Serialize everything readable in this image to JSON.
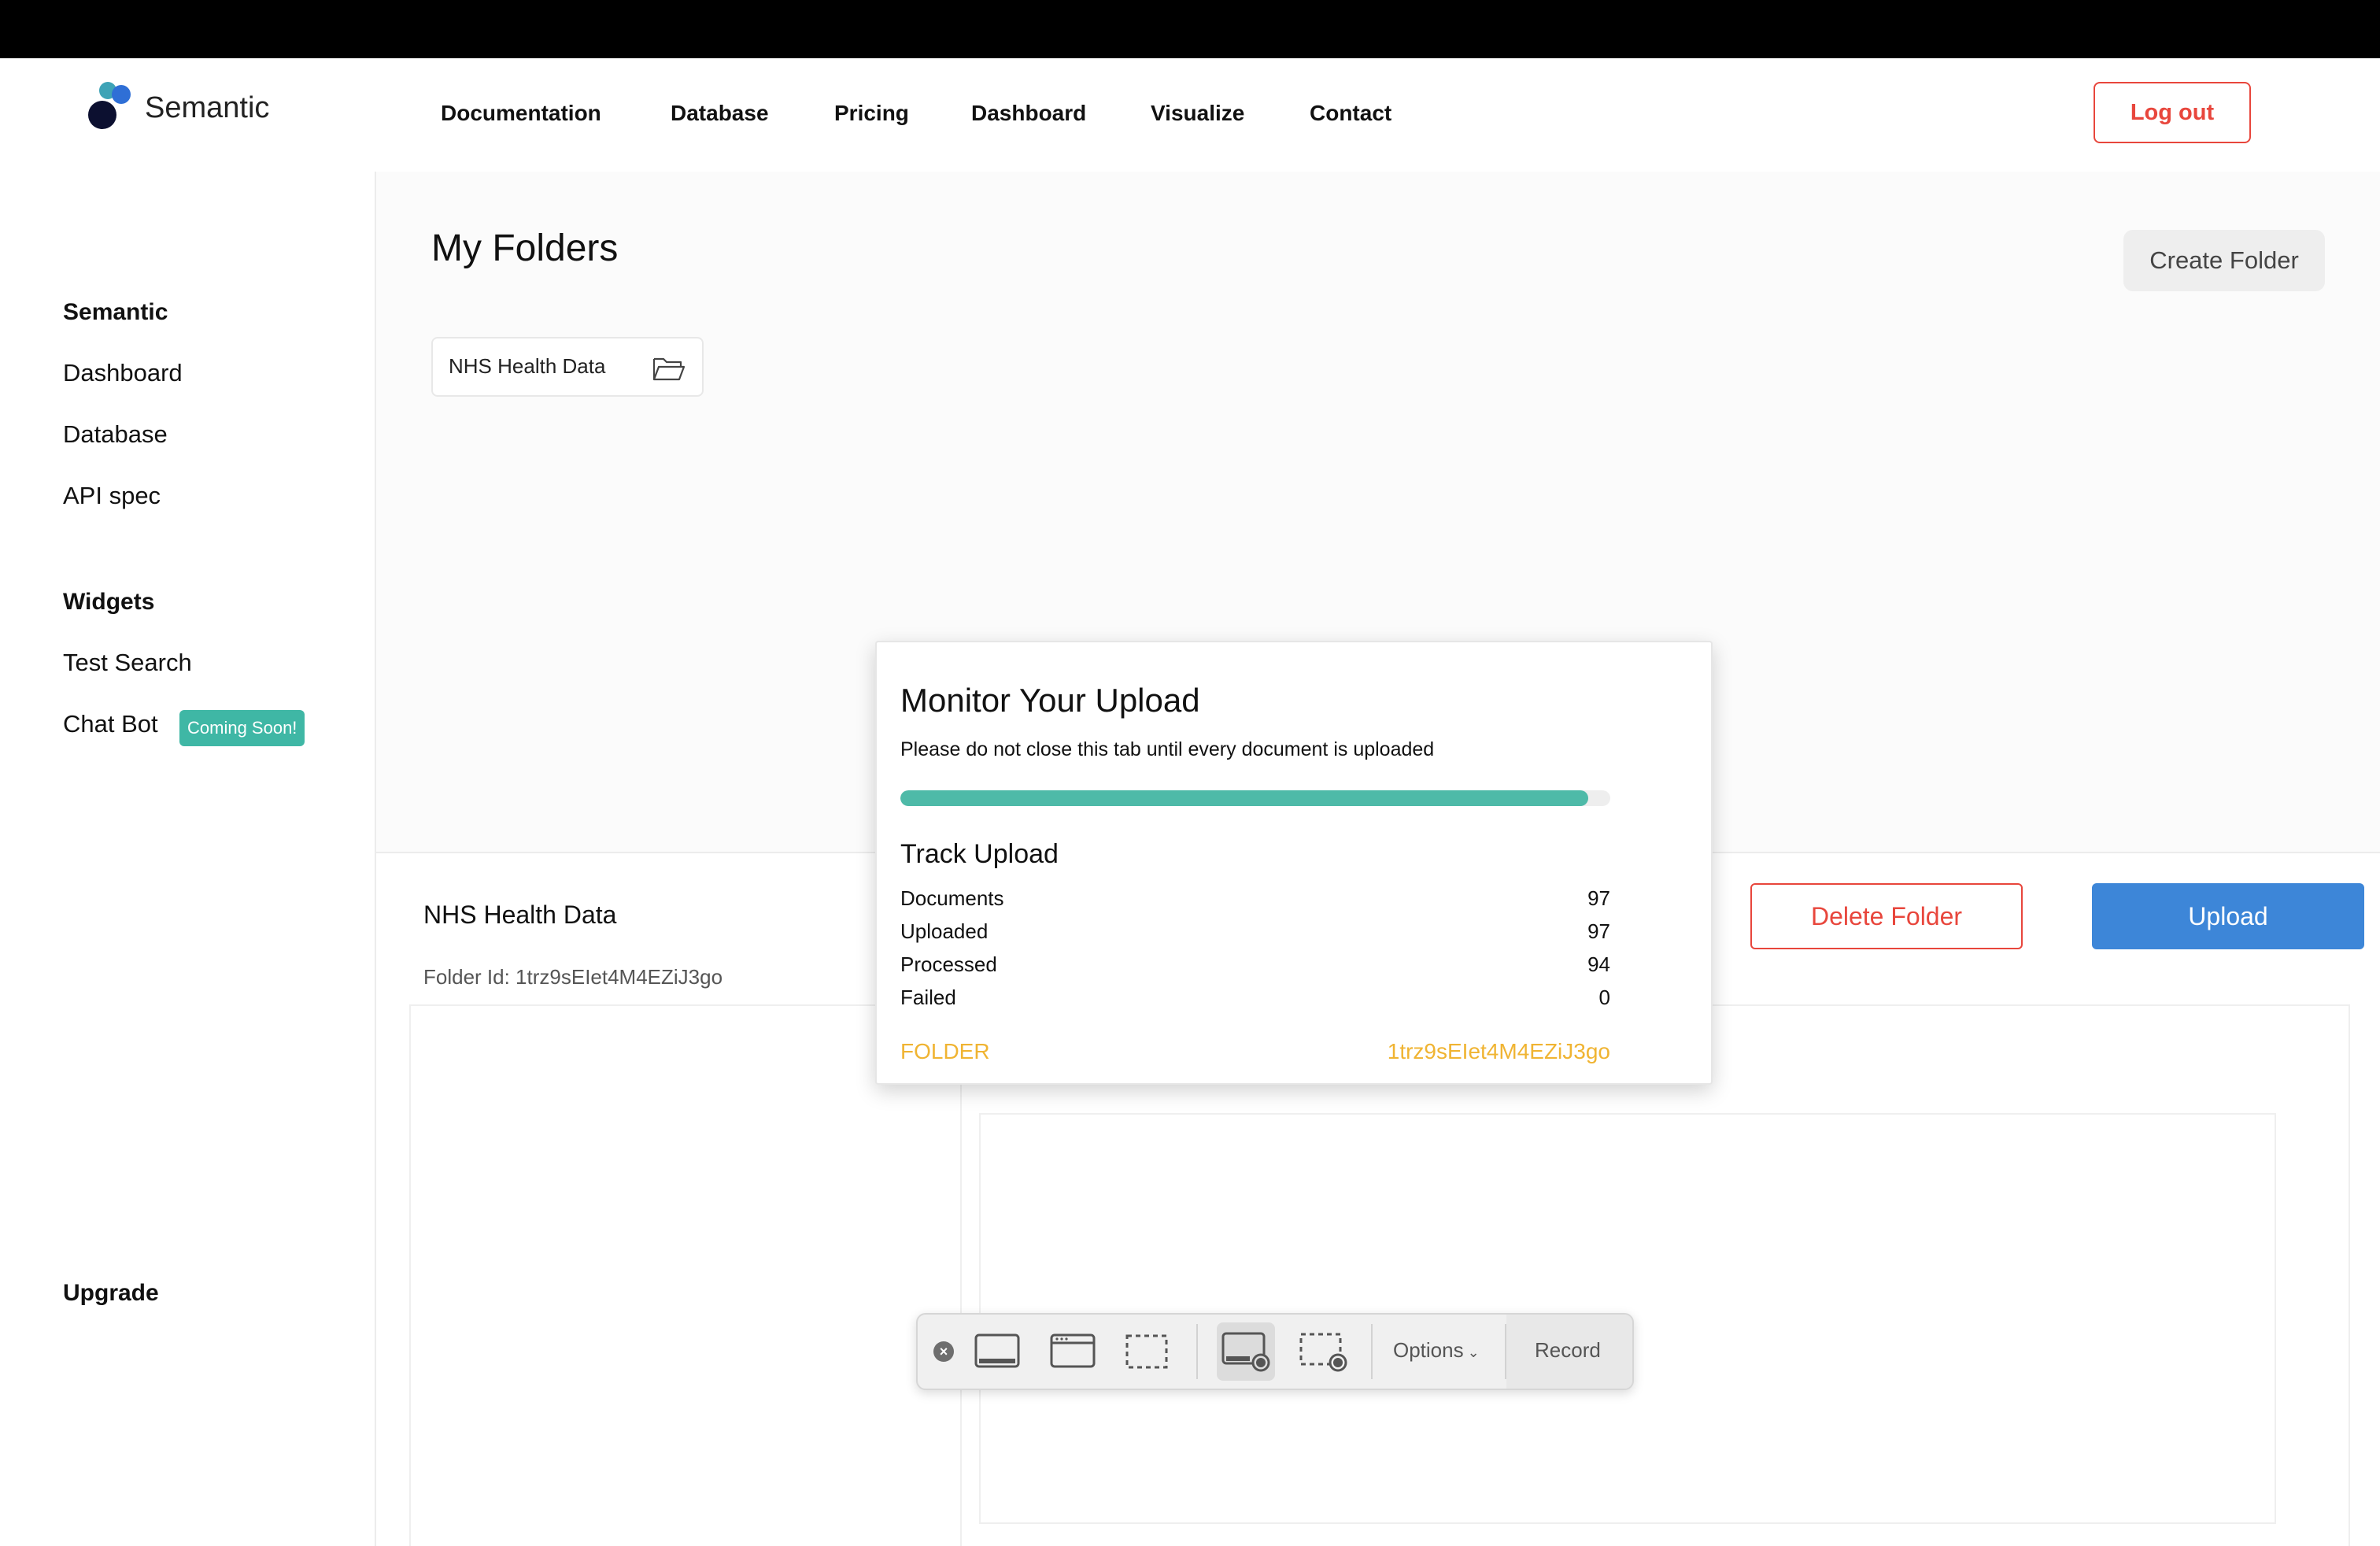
{
  "header": {
    "brand": "Semantic",
    "nav": [
      "Documentation",
      "Database",
      "Pricing",
      "Dashboard",
      "Visualize",
      "Contact"
    ],
    "logout_label": "Log out"
  },
  "sidebar": {
    "section1_title": "Semantic",
    "section1_items": [
      "Dashboard",
      "Database",
      "API spec"
    ],
    "section2_title": "Widgets",
    "section2_items": [
      "Test Search",
      "Chat Bot"
    ],
    "badge": "Coming Soon!",
    "upgrade": "Upgrade"
  },
  "main": {
    "title": "My Folders",
    "create_folder_label": "Create Folder",
    "folders": [
      {
        "name": "NHS Health Data",
        "icon": "folder-open-icon"
      }
    ],
    "selected_folder": {
      "name": "NHS Health Data",
      "id_text": "Folder Id: 1trz9sEIet4M4EZiJ3go",
      "delete_label": "Delete Folder",
      "upload_label": "Upload"
    }
  },
  "modal": {
    "title": "Monitor Your Upload",
    "subtitle": "Please do not close this tab until every document is uploaded",
    "progress_fraction": 0.969,
    "track_title": "Track Upload",
    "rows": [
      {
        "label": "Documents",
        "value": "97"
      },
      {
        "label": "Uploaded",
        "value": "97"
      },
      {
        "label": "Processed",
        "value": "94"
      },
      {
        "label": "Failed",
        "value": "0"
      }
    ],
    "folder_label": "FOLDER",
    "folder_value": "1trz9sEIet4M4EZiJ3go"
  },
  "toolbar": {
    "icons": [
      "close-icon",
      "capture-entire-screen-icon",
      "capture-window-icon",
      "capture-selection-icon",
      "record-entire-screen-icon",
      "record-selection-icon"
    ],
    "options_label": "Options",
    "record_label": "Record"
  },
  "colors": {
    "accent_red": "#e8463c",
    "accent_blue": "#3d86d8",
    "teal": "#4ebaa8",
    "badge_teal": "#3fb7a5",
    "folder_gold": "#f0b432"
  }
}
